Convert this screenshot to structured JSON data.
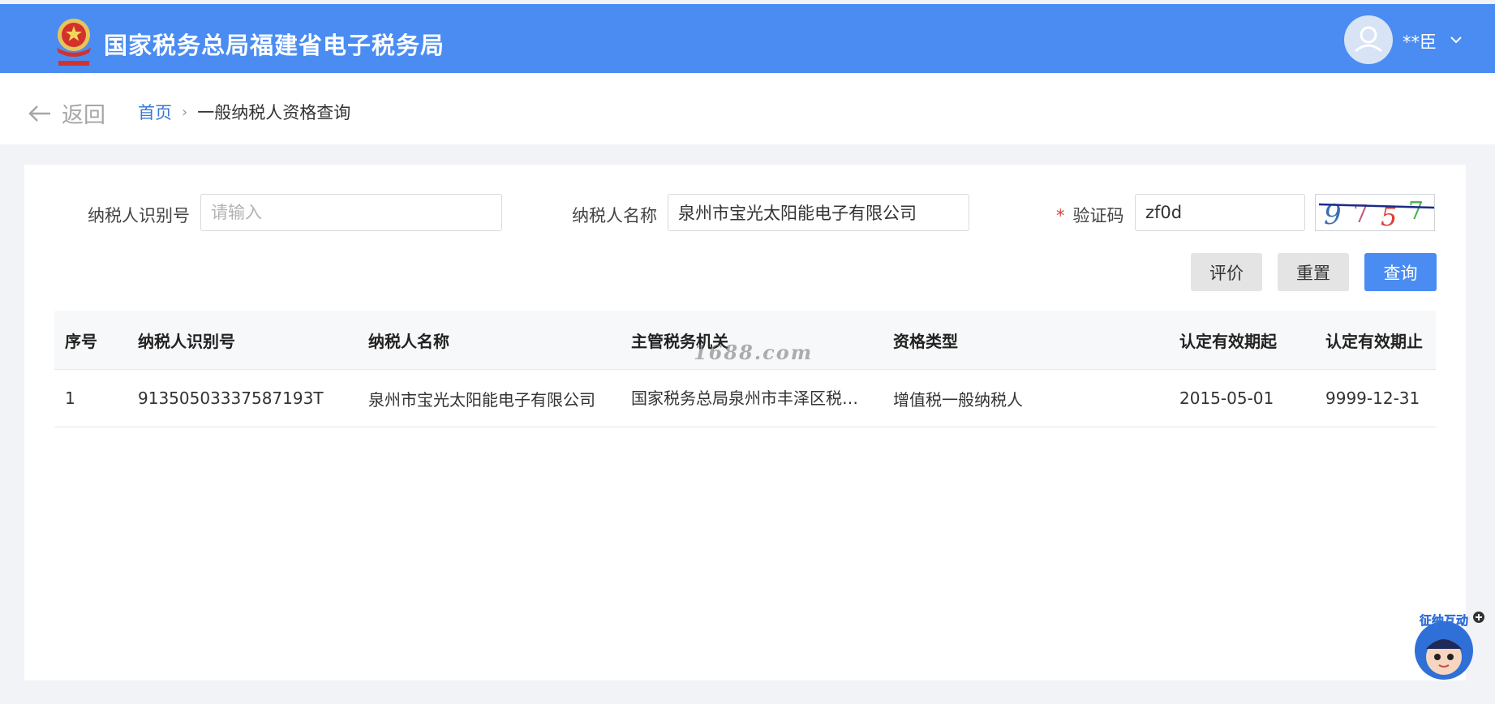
{
  "header": {
    "title": "国家税务总局福建省电子税务局",
    "logo_icon": "tax-emblem-icon",
    "user_name": "**臣"
  },
  "nav": {
    "back_label": "返回",
    "breadcrumb_home": "首页",
    "breadcrumb_sep": "›",
    "breadcrumb_current": "一般纳税人资格查询"
  },
  "form": {
    "taxpayer_id_label": "纳税人识别号",
    "taxpayer_id_placeholder": "请输入",
    "taxpayer_id_value": "",
    "taxpayer_name_label": "纳税人名称",
    "taxpayer_name_value": "泉州市宝光太阳能电子有限公司",
    "captcha_required": "*",
    "captcha_label": "验证码",
    "captcha_value": "zf0d",
    "captcha_image_text": "9757"
  },
  "buttons": {
    "evaluate": "评价",
    "reset": "重置",
    "query": "查询"
  },
  "table": {
    "headers": [
      "序号",
      "纳税人识别号",
      "纳税人名称",
      "主管税务机关",
      "资格类型",
      "认定有效期起",
      "认定有效期止"
    ],
    "rows": [
      [
        "1",
        "91350503337587193T",
        "泉州市宝光太阳能电子有限公司",
        "国家税务总局泉州市丰泽区税…",
        "增值税一般纳税人",
        "2015-05-01",
        "9999-12-31"
      ]
    ]
  },
  "watermark": "1688.com",
  "mascot_text": "征纳互动",
  "colors": {
    "primary": "#4a8cf2",
    "required": "#e23b3b",
    "link": "#3a78d8"
  }
}
